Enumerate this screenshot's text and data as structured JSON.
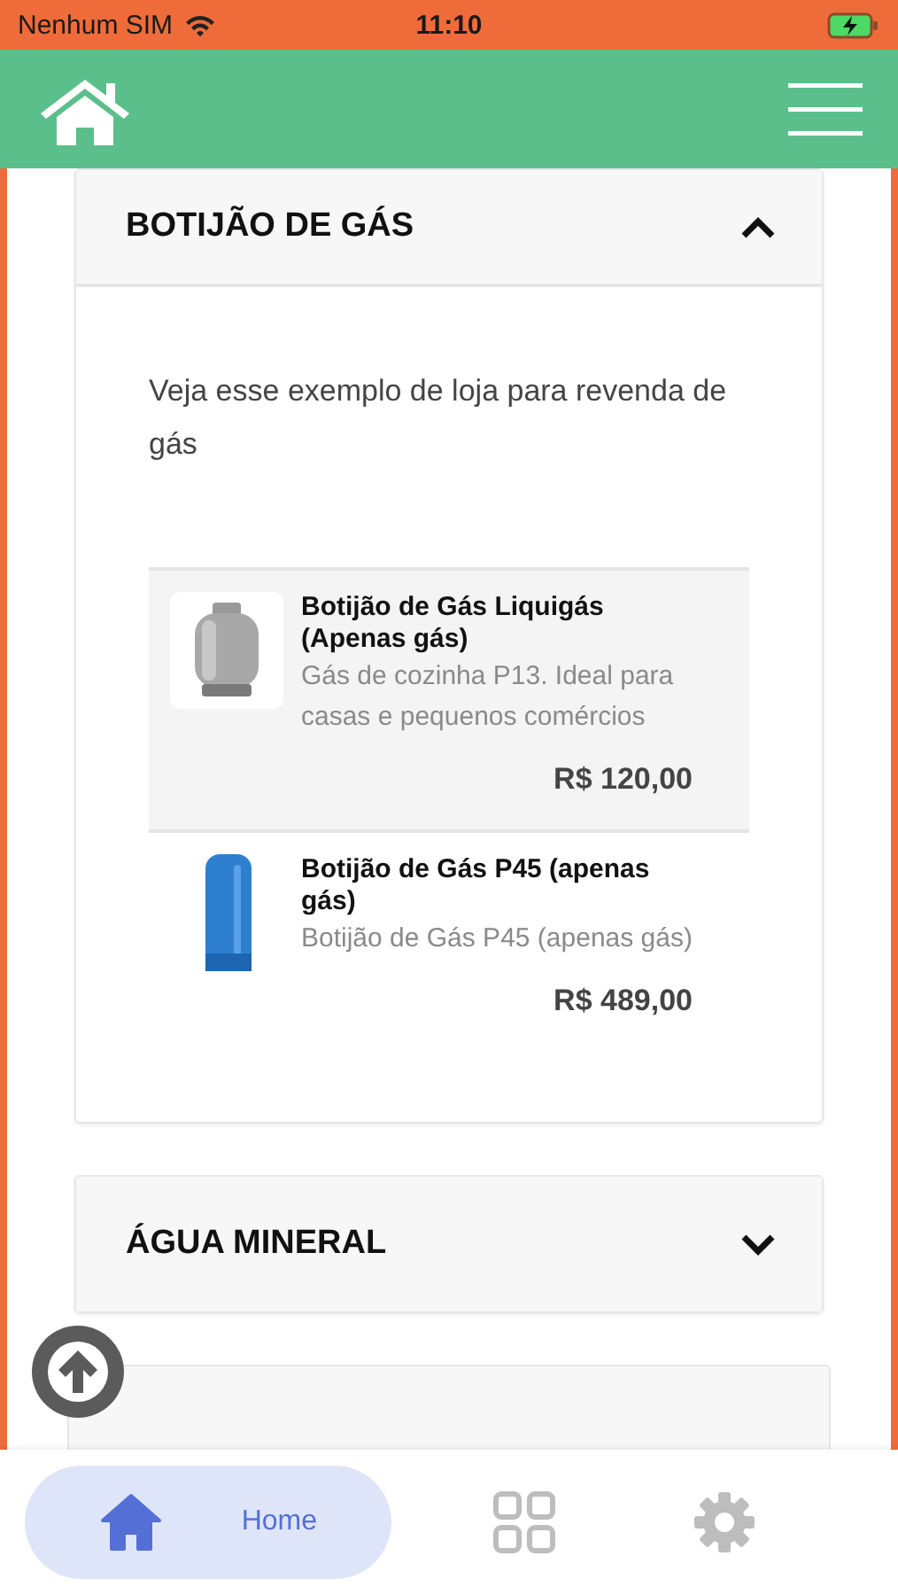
{
  "status_bar": {
    "carrier": "Nenhum SIM",
    "time": "11:10"
  },
  "sections": [
    {
      "title": "BOTIJÃO DE GÁS",
      "expanded": true,
      "intro": "Veja esse exemplo de loja para revenda de gás",
      "products": [
        {
          "name": "Botijão de Gás Liquigás (Apenas gás)",
          "description": "Gás de cozinha P13. Ideal para casas e pequenos comércios",
          "price": "R$ 120,00",
          "selected": true
        },
        {
          "name": "Botijão de Gás P45 (apenas gás)",
          "description": "Botijão de Gás P45 (apenas gás)",
          "price": "R$ 489,00",
          "selected": false
        }
      ]
    },
    {
      "title": "ÁGUA MINERAL",
      "expanded": false
    }
  ],
  "bottom_nav": [
    {
      "kind": "home",
      "label": "Home",
      "selected": true
    },
    {
      "kind": "grid",
      "selected": false
    },
    {
      "kind": "settings",
      "selected": false
    }
  ]
}
